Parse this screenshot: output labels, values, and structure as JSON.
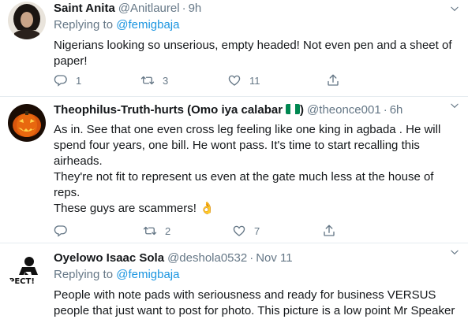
{
  "tweets": [
    {
      "name": "Saint Anita",
      "handle": "@Anitlaurel",
      "time": "9h",
      "replying_prefix": "Replying to ",
      "replying_to": "@femigbaja",
      "text": "Nigerians looking so unserious,  empty headed!  Not even pen and a sheet of paper!",
      "replies": "1",
      "retweets": "3",
      "likes": "11"
    },
    {
      "name": "Theophilus-Truth-hurts (Omo iya calabar",
      "name_suffix": ")",
      "handle": "@theonce001",
      "time": "6h",
      "text_lines": [
        "As in. See that one even cross leg feeling like one king in agbada . He will spend four years, one bill. He wont pass. It's time to start recalling this airheads.",
        "They're not fit to represent us even at the gate much less at the house of reps.",
        "These guys are scammers! 👌"
      ],
      "replies": "",
      "retweets": "2",
      "likes": "7"
    },
    {
      "name": "Oyelowo Isaac Sola",
      "handle": "@deshola0532",
      "time": "Nov 11",
      "replying_prefix": "Replying to ",
      "replying_to": "@femigbaja",
      "text": "People with note pads with seriousness and ready for business VERSUS people that just want to post for photo. This picture is a low point Mr Speaker",
      "avatar_text": "PECT!"
    }
  ],
  "separator": "·",
  "icons": [
    "reply-icon",
    "retweet-icon",
    "like-icon",
    "share-icon",
    "chevron-down-icon"
  ],
  "colors": {
    "link": "#1b95e0",
    "secondary": "#657786",
    "border": "#e6ecf0",
    "flag_green": "#008751"
  }
}
